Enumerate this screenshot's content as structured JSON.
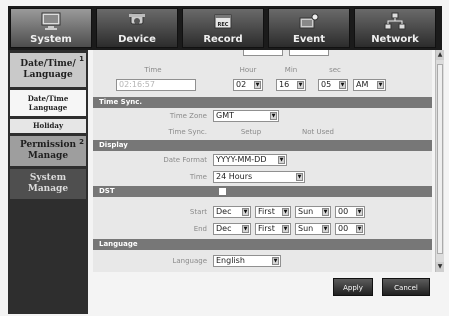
{
  "tabs": [
    {
      "label": "System",
      "icon": "monitor-icon",
      "active": true
    },
    {
      "label": "Device",
      "icon": "camera-icon",
      "active": false
    },
    {
      "label": "Record",
      "icon": "record-icon",
      "active": false
    },
    {
      "label": "Event",
      "icon": "event-icon",
      "active": false
    },
    {
      "label": "Network",
      "icon": "network-icon",
      "active": false
    }
  ],
  "nav": {
    "date_time_language": "Date/Time/ Language",
    "marker_1": "1",
    "sub_date_time": "Date/Time Language",
    "sub_holiday": "Holiday",
    "permission_manage": "Permission Manage",
    "marker_2": "2",
    "system_manage": "System Manage"
  },
  "time_row": {
    "time_label": "Time",
    "hour_label": "Hour",
    "min_label": "Min",
    "sec_label": "sec",
    "time_value": "02:16:57",
    "hour_value": "02",
    "min_value": "16",
    "sec_value": "05",
    "ampm_value": "AM"
  },
  "time_sync": {
    "header": "Time Sync.",
    "time_zone_label": "Time Zone",
    "time_zone_value": "GMT",
    "time_sync_label": "Time Sync.",
    "setup_label": "Setup",
    "status_label": "Not Used"
  },
  "display": {
    "header": "Display",
    "date_format_label": "Date Format",
    "date_format_value": "YYYY-MM-DD",
    "time_label": "Time",
    "time_value": "24 Hours"
  },
  "dst": {
    "header": "DST",
    "checked": false,
    "start_label": "Start",
    "start_month": "Dec",
    "start_week": "First",
    "start_day": "Sun",
    "start_hour": "00",
    "end_label": "End",
    "end_month": "Dec",
    "end_week": "First",
    "end_day": "Sun",
    "end_hour": "00"
  },
  "language": {
    "header": "Language",
    "label": "Language",
    "value": "English"
  },
  "buttons": {
    "apply": "Apply",
    "cancel": "Cancel"
  },
  "colors": {
    "section_header": "#777777",
    "panel": "#e8e8e8",
    "tab_bar": "#1b1b1b",
    "nav_active": "#c9c9c9"
  }
}
